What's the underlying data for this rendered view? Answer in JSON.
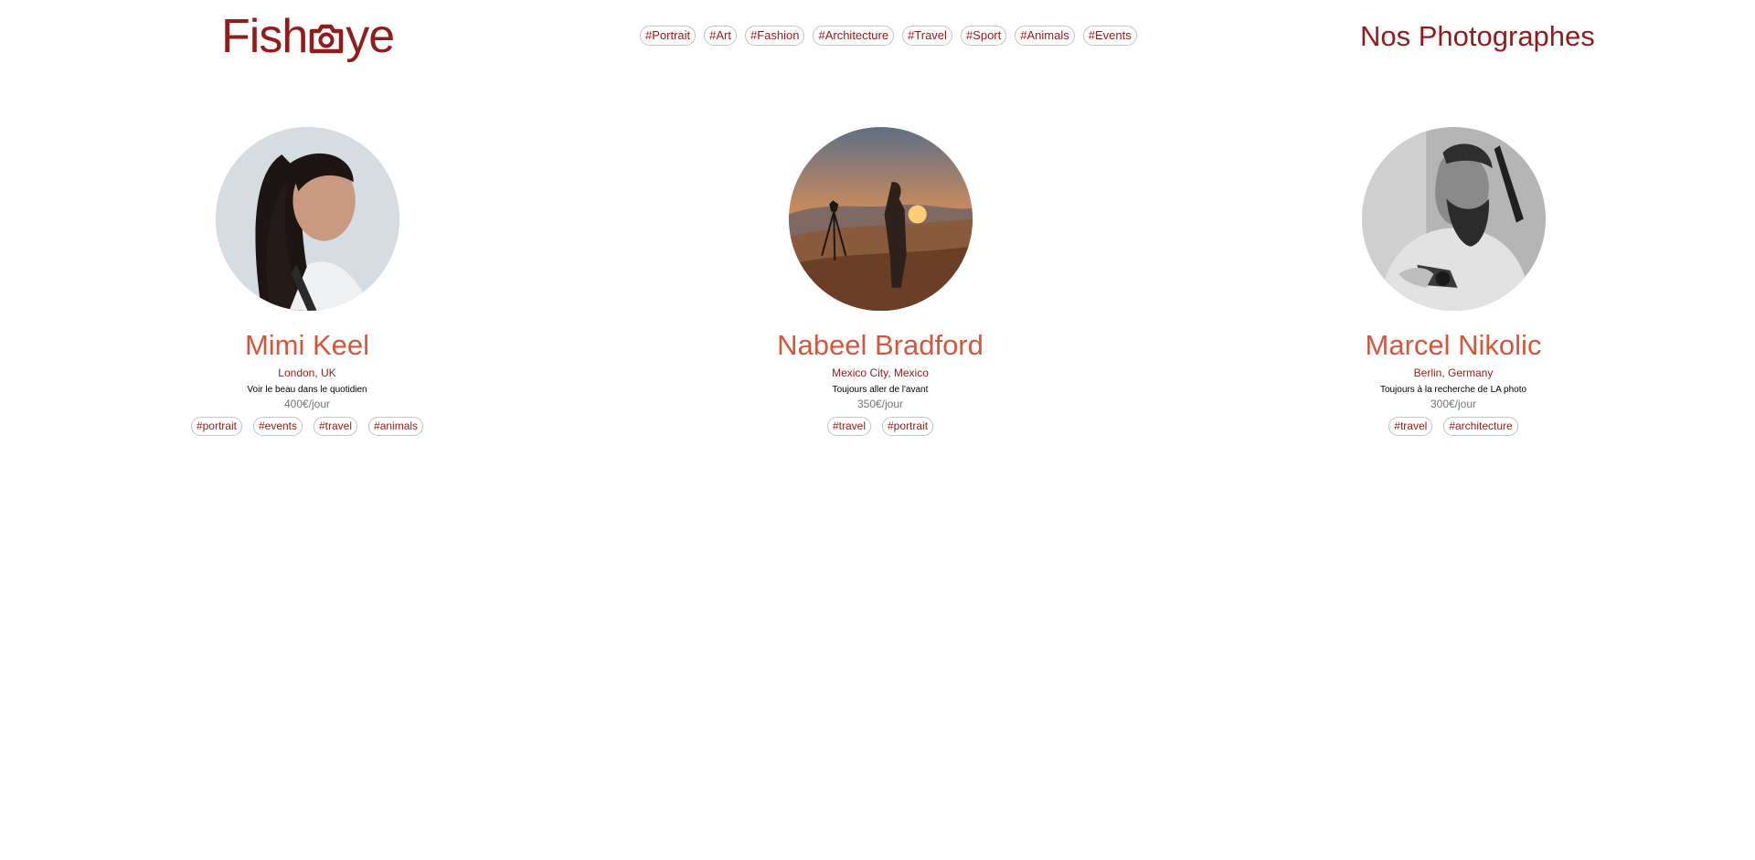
{
  "header": {
    "logo_before": "Fish",
    "logo_after": "ye",
    "logo_icon": "camera-icon",
    "title": "Nos Photographes",
    "nav_tags": [
      "#Portrait",
      "#Art",
      "#Fashion",
      "#Architecture",
      "#Travel",
      "#Sport",
      "#Animals",
      "#Events"
    ]
  },
  "photographers": [
    {
      "name": "Mimi Keel",
      "location": "London, UK",
      "tagline": "Voir le beau dans le quotidien",
      "price": "400€/jour",
      "tags": [
        "#portrait",
        "#events",
        "#travel",
        "#animals"
      ]
    },
    {
      "name": "Nabeel Bradford",
      "location": "Mexico City, Mexico",
      "tagline": "Toujours aller de l'avant",
      "price": "350€/jour",
      "tags": [
        "#travel",
        "#portrait"
      ]
    },
    {
      "name": "Marcel Nikolic",
      "location": "Berlin, Germany",
      "tagline": "Toujours à la recherche de LA photo",
      "price": "300€/jour",
      "tags": [
        "#travel",
        "#architecture"
      ]
    }
  ],
  "colors": {
    "brand": "#901c1c",
    "accent": "#d3573c",
    "muted": "#757575",
    "tag_border": "#c4c4c4"
  }
}
